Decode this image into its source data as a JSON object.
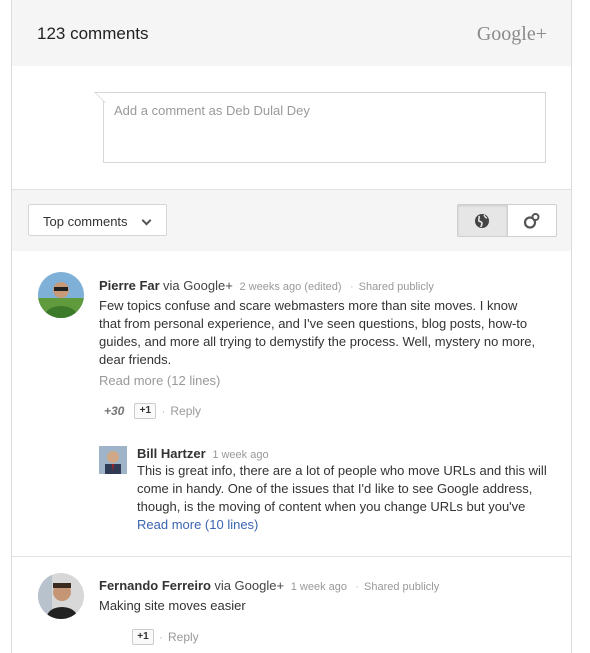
{
  "header": {
    "comment_count": "123 comments",
    "brand": "Google+"
  },
  "compose": {
    "placeholder": "Add a comment as Deb Dulal Dey"
  },
  "toolbar": {
    "sort_label": "Top comments",
    "view_options": [
      "globe-icon",
      "circles-icon"
    ],
    "active_view": "globe-icon"
  },
  "comments": [
    {
      "author": "Pierre Far",
      "via": "via Google+",
      "time": "2 weeks ago (edited)",
      "visibility": "Shared publicly",
      "text": "Few topics confuse and scare webmasters more than site moves. I know that from personal experience, and I've seen questions, blog posts, how-to guides, and more all trying to demystify the process. Well, mystery no more, dear friends.",
      "read_more": "Read more (12 lines)",
      "plus_count": "+30",
      "plus_label": "+1",
      "reply": "Reply",
      "replies": [
        {
          "author": "Bill Hartzer",
          "time": "1 week ago",
          "text": "This is great info, there are a lot of people who move URLs and this will come in handy. One of the issues that I'd like to see Google address, though, is the moving of content when you change URLs but you've",
          "read_more": "Read more (10 lines)"
        }
      ]
    },
    {
      "author": "Fernando Ferreiro",
      "via": "via Google+",
      "time": "1 week ago",
      "visibility": "Shared publicly",
      "text": "Making site moves easier",
      "plus_label": "+1",
      "reply": "Reply"
    }
  ],
  "separator": "·"
}
